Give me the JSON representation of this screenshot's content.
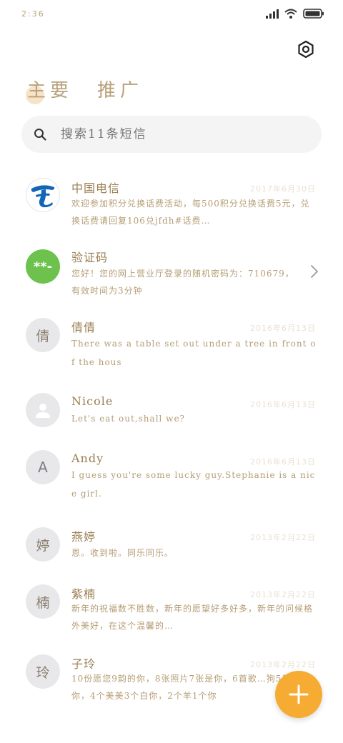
{
  "status": {
    "time": "2:36"
  },
  "header": {
    "tab_primary": "主要",
    "tab_secondary": "推广"
  },
  "search": {
    "placeholder": "搜索11条短信"
  },
  "conversations": [
    {
      "name": "中国电信",
      "date": "2017年6月30日",
      "preview": "欢迎参加积分兑换话费活动，每500积分兑换话费5元，兑换话费请回复106兑jfdh#话费…"
    },
    {
      "name": "验证码",
      "date": "",
      "preview": "您好！您的网上营业厅登录的随机密码为：710679，有效时间为3分钟"
    },
    {
      "name": "倩倩",
      "date": "2016年6月13日",
      "preview": "There was a table set out under a tree in front of the hous"
    },
    {
      "name": "Nicole",
      "date": "2016年6月13日",
      "preview": "Let's eat out,shall we?"
    },
    {
      "name": "Andy",
      "date": "2016年6月13日",
      "preview": "I guess you're some lucky guy.Stephanie is a nice girl."
    },
    {
      "name": "燕婷",
      "date": "2013年2月22日",
      "preview": "恩。收到啦。同乐同乐。"
    },
    {
      "name": "紫楠",
      "date": "2013年2月22日",
      "preview": "新年的祝福数不胜数，新年的愿望好多好多，新年的问候格外美好，在这个温馨的…"
    },
    {
      "name": "子玲",
      "date": "2013年2月22日",
      "preview": "10份愿您9韵的你，8张照片7张是你，6首歌…狗5只猫你，4个美美3个白你，2个羊1个你"
    }
  ],
  "avatars": {
    "verify": "**-",
    "qianqian": "倩",
    "andy": "A",
    "yanting": "婷",
    "zinan": "楠",
    "ziling": "玲"
  },
  "icons": {
    "settings": "hexagon-settings-icon",
    "search": "search-icon",
    "add": "plus-icon",
    "chevron": "chevron-right-icon",
    "person": "person-icon"
  },
  "colors": {
    "fab": "#f6ab32",
    "verify_avatar": "#6cc24c",
    "telecom_blue": "#1166b8"
  }
}
